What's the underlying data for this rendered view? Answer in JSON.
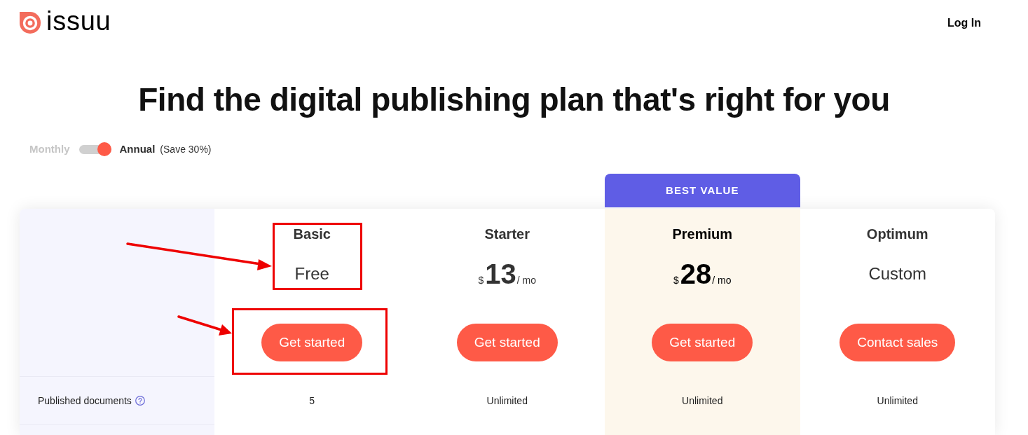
{
  "header": {
    "logo_text": "issuu",
    "login": "Log In"
  },
  "heading": "Find the digital publishing plan that's right for you",
  "billing_toggle": {
    "left_label": "Monthly",
    "right_label": "Annual",
    "on": true,
    "note": "(Save 30%)"
  },
  "plans": [
    {
      "name": "Basic",
      "price": {
        "kind": "text",
        "text": "Free"
      },
      "button": "Get started",
      "highlighted": false
    },
    {
      "name": "Starter",
      "price": {
        "kind": "amount",
        "currency": "$",
        "amount": "13",
        "period": "/ mo"
      },
      "button": "Get started",
      "highlighted": false
    },
    {
      "name": "Premium",
      "price": {
        "kind": "amount",
        "currency": "$",
        "amount": "28",
        "period": "/ mo"
      },
      "button": "Get started",
      "highlighted": true,
      "badge": "BEST VALUE"
    },
    {
      "name": "Optimum",
      "price": {
        "kind": "text",
        "text": "Custom"
      },
      "button": "Contact sales",
      "highlighted": false
    }
  ],
  "features": [
    {
      "label": "Published documents",
      "help": true,
      "values": [
        "5",
        "Unlimited",
        "Unlimited",
        "Unlimited"
      ]
    }
  ]
}
